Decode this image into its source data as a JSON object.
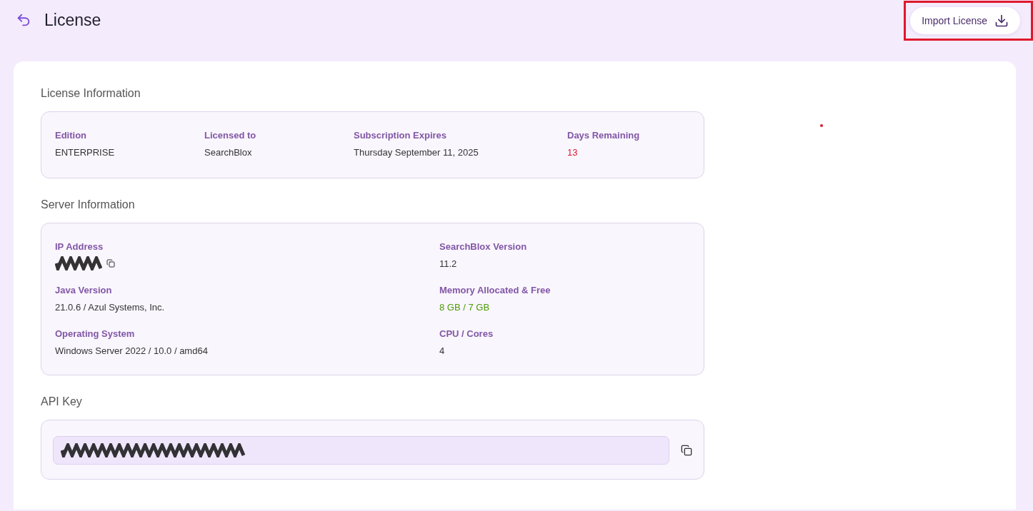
{
  "header": {
    "title": "License",
    "import_button": {
      "label": "Import License",
      "highlighted": true
    }
  },
  "license_information": {
    "title": "License Information",
    "fields": [
      {
        "label": "Edition",
        "value": "ENTERPRISE"
      },
      {
        "label": "Licensed to",
        "value": "SearchBlox"
      },
      {
        "label": "Subscription Expires",
        "value": "Thursday September 11, 2025"
      },
      {
        "label": "Days Remaining",
        "value": "13",
        "color": "#e0182d"
      }
    ]
  },
  "server_information": {
    "title": "Server Information",
    "fields": [
      {
        "label": "IP Address",
        "redacted": true,
        "copyable": true
      },
      {
        "label": "SearchBlox Version",
        "value": "11.2"
      },
      {
        "label": "Java Version",
        "value": "21.0.6 / Azul Systems, Inc."
      },
      {
        "label": "Memory Allocated & Free",
        "value": "8 GB / 7 GB",
        "color": "#4e9a06"
      },
      {
        "label": "Operating System",
        "value": "Windows Server 2022 / 10.0 / amd64"
      },
      {
        "label": "CPU / Cores",
        "value": "4"
      }
    ]
  },
  "api_key": {
    "title": "API Key",
    "redacted": true
  }
}
